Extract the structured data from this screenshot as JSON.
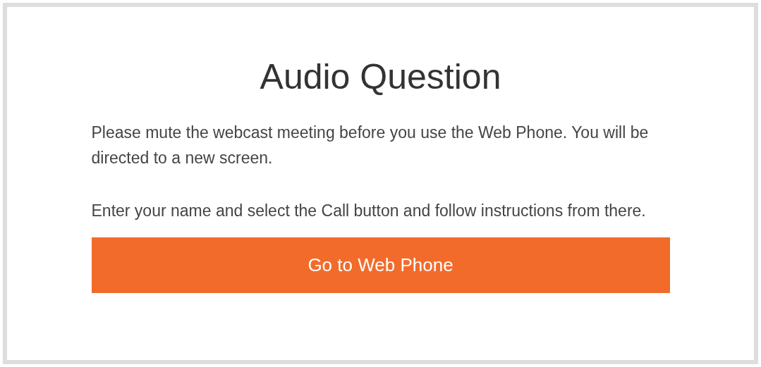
{
  "title": "Audio Question",
  "paragraphs": [
    "Please mute the webcast meeting before you use the Web Phone. You will be directed to a new screen.",
    "Enter your name and select the Call button and follow instructions from there."
  ],
  "button": {
    "label": "Go to Web Phone"
  }
}
